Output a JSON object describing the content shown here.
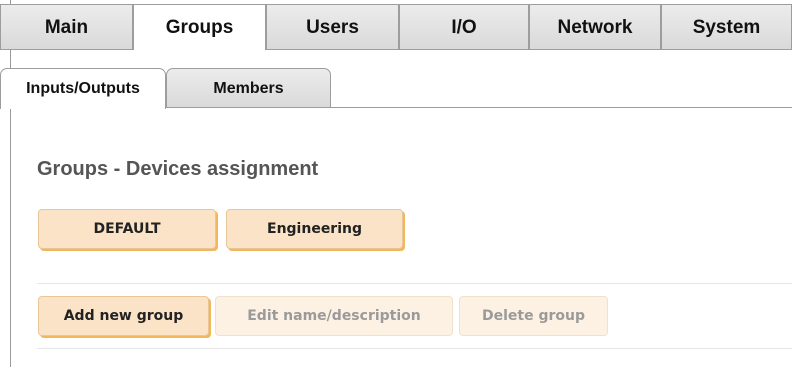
{
  "main_tabs": [
    {
      "label": "Main",
      "active": false
    },
    {
      "label": "Groups",
      "active": true
    },
    {
      "label": "Users",
      "active": false
    },
    {
      "label": "I/O",
      "active": false
    },
    {
      "label": "Network",
      "active": false
    },
    {
      "label": "System",
      "active": false
    }
  ],
  "sub_tabs": [
    {
      "label": "Inputs/Outputs",
      "active": true
    },
    {
      "label": "Members",
      "active": false
    }
  ],
  "section_title": "Groups - Devices assignment",
  "groups": [
    "DEFAULT",
    "Engineering"
  ],
  "actions": {
    "add": "Add new group",
    "edit": "Edit name/description",
    "delete": "Delete group"
  },
  "colors": {
    "button_bg": "#fbe3c8",
    "button_shadow": "#f2b75c",
    "disabled_bg": "#fdf1e4",
    "title": "#555555"
  }
}
